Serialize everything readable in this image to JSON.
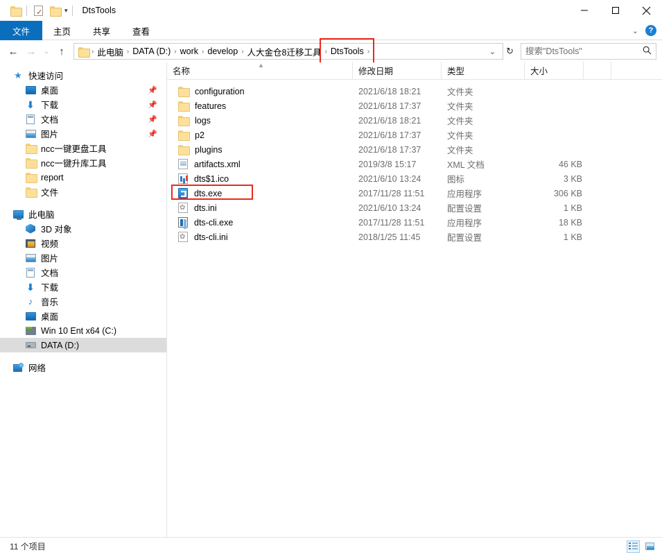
{
  "window": {
    "title": "DtsTools",
    "quick_access": [
      {
        "name": "folder-icon",
        "label": "保存"
      },
      {
        "name": "properties-icon",
        "label": "属性"
      },
      {
        "name": "new-folder-icon",
        "label": "新建文件夹"
      }
    ],
    "qat_dropdown": "▾",
    "controls": {
      "minimize": "—",
      "maximize": "□",
      "close": "✕"
    }
  },
  "ribbon": {
    "tabs": [
      {
        "label": "文件",
        "active": true
      },
      {
        "label": "主页",
        "active": false
      },
      {
        "label": "共享",
        "active": false
      },
      {
        "label": "查看",
        "active": false
      }
    ],
    "expand_caret": "⌄",
    "help_label": "?"
  },
  "address": {
    "back": "←",
    "forward": "→",
    "recent": "⌄",
    "up": "↑",
    "separator": "›",
    "crumbs": [
      {
        "label": "此电脑",
        "highlighted": false
      },
      {
        "label": "DATA (D:)",
        "highlighted": false
      },
      {
        "label": "work",
        "highlighted": false
      },
      {
        "label": "develop",
        "highlighted": false
      },
      {
        "label": "人大金仓8迁移工具",
        "highlighted": false
      },
      {
        "label": "DtsTools",
        "highlighted": true
      }
    ],
    "dropdown_caret": "⌄",
    "refresh": "↻",
    "highlight_color": "#e8291c"
  },
  "search": {
    "placeholder": "搜索\"DtsTools\"",
    "value": "",
    "icon": "search-icon"
  },
  "sidebar": {
    "groups": [
      {
        "header": {
          "label": "快速访问",
          "icon": "star-icon"
        },
        "items": [
          {
            "label": "桌面",
            "icon": "desktop-icon",
            "pinned": true
          },
          {
            "label": "下载",
            "icon": "download-icon",
            "pinned": true
          },
          {
            "label": "文档",
            "icon": "documents-icon",
            "pinned": true
          },
          {
            "label": "图片",
            "icon": "pictures-icon",
            "pinned": true
          },
          {
            "label": "ncc一键更盘工具",
            "icon": "folder-icon",
            "pinned": false
          },
          {
            "label": "ncc一键升库工具",
            "icon": "folder-icon",
            "pinned": false
          },
          {
            "label": "report",
            "icon": "folder-icon",
            "pinned": false
          },
          {
            "label": "文件",
            "icon": "folder-icon",
            "pinned": false
          }
        ]
      },
      {
        "header": {
          "label": "此电脑",
          "icon": "this-pc-icon"
        },
        "items": [
          {
            "label": "3D 对象",
            "icon": "3d-objects-icon",
            "pinned": false
          },
          {
            "label": "视频",
            "icon": "videos-icon",
            "pinned": false
          },
          {
            "label": "图片",
            "icon": "pictures-icon",
            "pinned": false
          },
          {
            "label": "文档",
            "icon": "documents-icon",
            "pinned": false
          },
          {
            "label": "下载",
            "icon": "download-icon",
            "pinned": false
          },
          {
            "label": "音乐",
            "icon": "music-icon",
            "pinned": false
          },
          {
            "label": "桌面",
            "icon": "desktop-icon",
            "pinned": false
          },
          {
            "label": "Win 10 Ent x64 (C:)",
            "icon": "c-drive-icon",
            "pinned": false
          },
          {
            "label": "DATA (D:)",
            "icon": "d-drive-icon",
            "pinned": false,
            "selected": true
          }
        ]
      },
      {
        "header": {
          "label": "网络",
          "icon": "network-icon"
        },
        "items": []
      }
    ]
  },
  "filelist": {
    "columns": [
      {
        "label": "名称",
        "sorted": "asc"
      },
      {
        "label": "修改日期",
        "sorted": null
      },
      {
        "label": "类型",
        "sorted": null
      },
      {
        "label": "大小",
        "sorted": null
      }
    ],
    "sort_caret": "▲",
    "rows": [
      {
        "name": "configuration",
        "date": "2021/6/18 18:21",
        "type": "文件夹",
        "size": "",
        "icon": "folder-icon",
        "highlighted": false
      },
      {
        "name": "features",
        "date": "2021/6/18 17:37",
        "type": "文件夹",
        "size": "",
        "icon": "folder-icon",
        "highlighted": false
      },
      {
        "name": "logs",
        "date": "2021/6/18 18:21",
        "type": "文件夹",
        "size": "",
        "icon": "folder-icon",
        "highlighted": false
      },
      {
        "name": "p2",
        "date": "2021/6/18 17:37",
        "type": "文件夹",
        "size": "",
        "icon": "folder-icon",
        "highlighted": false
      },
      {
        "name": "plugins",
        "date": "2021/6/18 17:37",
        "type": "文件夹",
        "size": "",
        "icon": "folder-icon",
        "highlighted": false
      },
      {
        "name": "artifacts.xml",
        "date": "2019/3/8 15:17",
        "type": "XML 文档",
        "size": "46 KB",
        "icon": "xml-file-icon",
        "highlighted": false
      },
      {
        "name": "dts$1.ico",
        "date": "2021/6/10 13:24",
        "type": "图标",
        "size": "3 KB",
        "icon": "ico-file-icon",
        "highlighted": false
      },
      {
        "name": "dts.exe",
        "date": "2017/11/28 11:51",
        "type": "应用程序",
        "size": "306 KB",
        "icon": "exe-file-icon",
        "highlighted": true
      },
      {
        "name": "dts.ini",
        "date": "2021/6/10 13:24",
        "type": "配置设置",
        "size": "1 KB",
        "icon": "ini-file-icon",
        "highlighted": false
      },
      {
        "name": "dts-cli.exe",
        "date": "2017/11/28 11:51",
        "type": "应用程序",
        "size": "18 KB",
        "icon": "cli-exe-file-icon",
        "highlighted": false
      },
      {
        "name": "dts-cli.ini",
        "date": "2018/1/25 11:45",
        "type": "配置设置",
        "size": "1 KB",
        "icon": "ini-file-icon",
        "highlighted": false
      }
    ]
  },
  "statusbar": {
    "item_count": "11 个项目",
    "views": [
      {
        "name": "details-view-button",
        "active": true
      },
      {
        "name": "large-icons-view-button",
        "active": false
      }
    ]
  }
}
